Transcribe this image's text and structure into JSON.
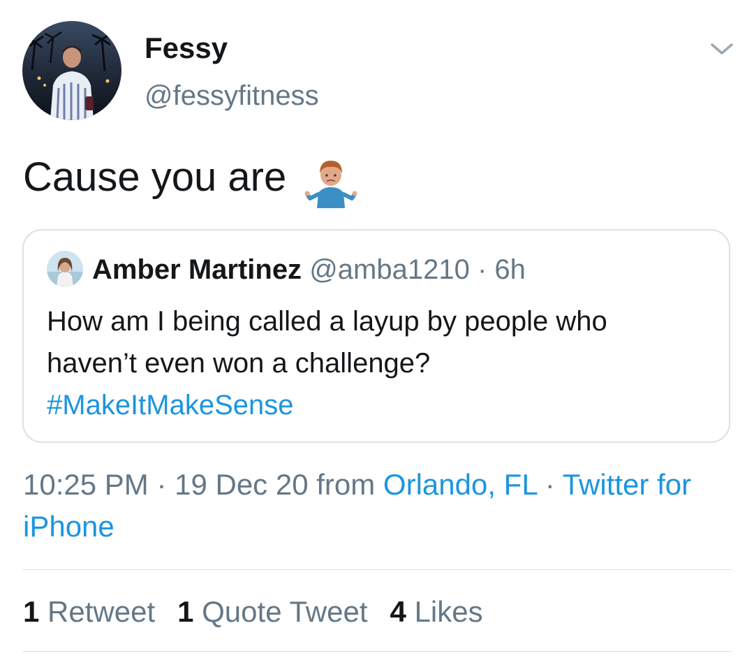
{
  "author": {
    "display_name": "Fessy",
    "handle": "@fessyfitness",
    "avatar_icon": "profile-photo"
  },
  "menu": {
    "icon": "chevron-down-icon"
  },
  "tweet": {
    "text": "Cause you are",
    "emoji": "person-shrugging-emoji"
  },
  "quoted_tweet": {
    "display_name": "Amber Martinez",
    "handle": "@amba1210",
    "separator": "·",
    "time": "6h",
    "text_lines": [
      "How am I being called a layup by people who",
      "haven’t even won a challenge?",
      "#MakeItMakeSense"
    ]
  },
  "meta": {
    "time": "10:25 PM",
    "sep1": " · ",
    "date": "19 Dec 20",
    "from": " from ",
    "location": "Orlando, FL",
    "sep2": " · ",
    "source": "Twitter for iPhone"
  },
  "stats": {
    "retweets_count": "1",
    "retweets_label": "Retweet",
    "quotes_count": "1",
    "quotes_label": "Quote Tweet",
    "likes_count": "4",
    "likes_label": "Likes"
  },
  "colors": {
    "link": "#1b95e0",
    "secondary_text": "#657786",
    "border": "#d9e1e8",
    "primary_text": "#14171a"
  }
}
